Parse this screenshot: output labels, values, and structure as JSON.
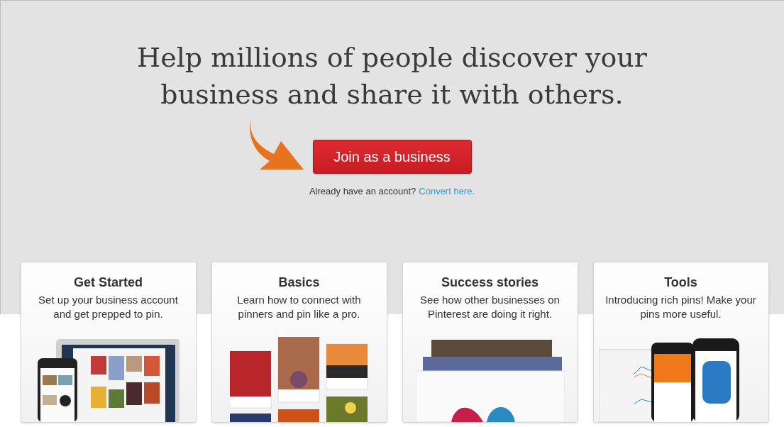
{
  "headline": [
    "Help millions of people discover your",
    "business and share it with others."
  ],
  "cta": {
    "label": "Join as a business"
  },
  "account_prompt": {
    "text": "Already have an account?",
    "link": "Convert here."
  },
  "cards": [
    {
      "title": "Get Started",
      "description": "Set up your business account and get prepped to pin.",
      "kind": "devices"
    },
    {
      "title": "Basics",
      "description": "Learn how to connect with pinners and pin like a pro.",
      "kind": "pins"
    },
    {
      "title": "Success stories",
      "description": "See how other businesses on Pinterest are doing it right.",
      "kind": "stories"
    },
    {
      "title": "Tools",
      "description": "Introducing rich pins! Make your pins more useful.",
      "kind": "phones"
    }
  ]
}
